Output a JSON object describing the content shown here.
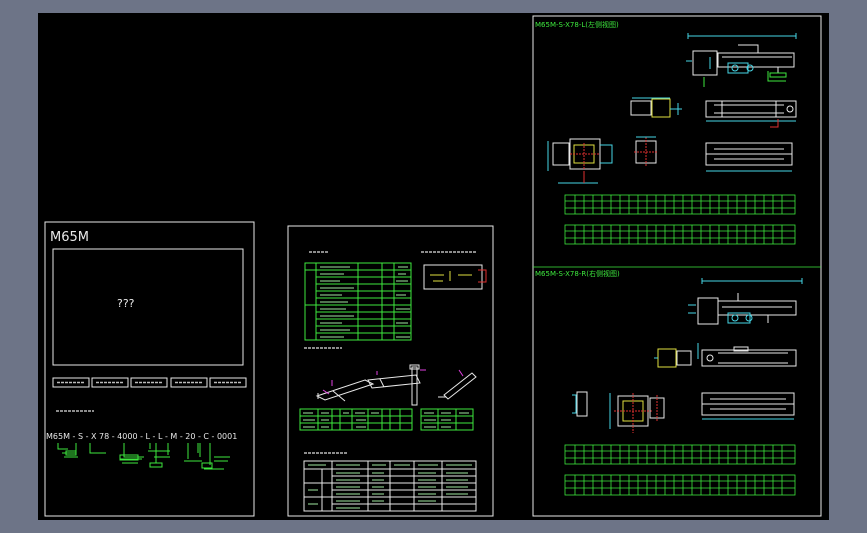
{
  "colors": {
    "background": "#6d7487",
    "drawing_area": "#000000",
    "line": "#e8e8e8",
    "green": "#3ee83e",
    "cyan": "#46d6e6",
    "magenta": "#e040e0",
    "yellow": "#e0e040",
    "red": "#e03030"
  },
  "left_sheet": {
    "title": "M65M",
    "placeholder": "???",
    "order_code": "M65M - S - X 78 - 4000 - L - L - M - 20 - C - 0001"
  },
  "right_sheet": {
    "view_left_title": "M65M-S-X78-L(左侧视图)",
    "view_right_title": "M65M-S-X78-R(右侧视图)"
  }
}
